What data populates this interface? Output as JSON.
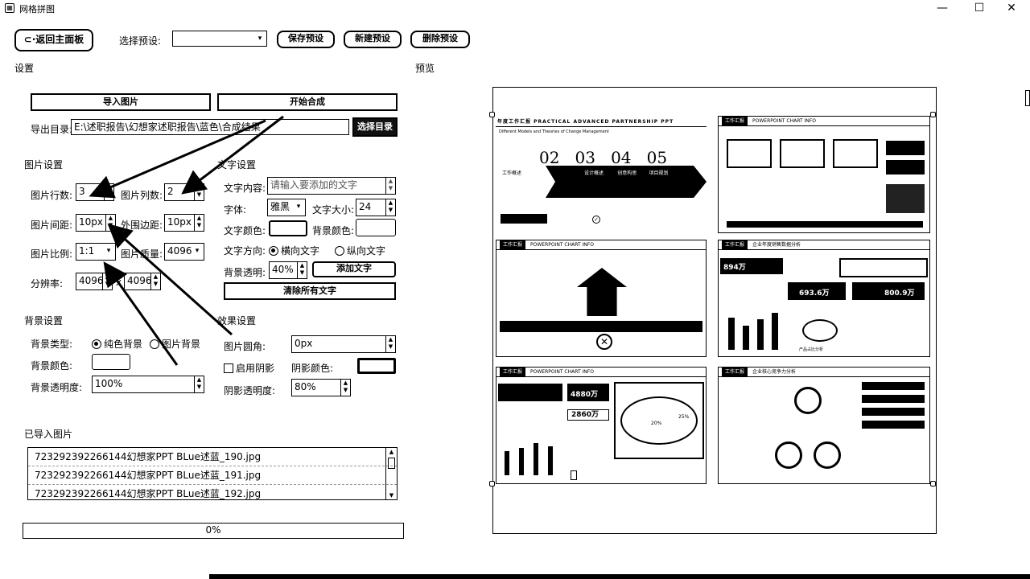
{
  "window": {
    "title": "网格拼图",
    "minimize": "—",
    "maximize": "☐",
    "close": "✕"
  },
  "toolbar": {
    "back_label": "返回主面板",
    "preset_label": "选择预设:",
    "preset_value": "",
    "save_preset": "保存预设",
    "new_preset": "新建预设",
    "delete_preset": "删除预设"
  },
  "settings": {
    "header": "设置",
    "import_button": "导入图片",
    "start_button": "开始合成",
    "export_label": "导出目录:",
    "export_path": "E:\\述职报告\\幻想家述职报告\\蓝色\\合成结果",
    "choose_dir": "选择目录"
  },
  "image_settings": {
    "header": "图片设置",
    "rows_label": "图片行数:",
    "rows_value": "3",
    "cols_label": "图片列数:",
    "cols_value": "2",
    "spacing_label": "图片间距:",
    "spacing_value": "10px",
    "margin_label": "外围边距:",
    "margin_value": "10px",
    "ratio_label": "图片比例:",
    "ratio_value": "1:1",
    "quality_label": "图片质量:",
    "quality_value": "4096",
    "resolution_label": "分辨率:",
    "res_w": "4096",
    "res_x": "x",
    "res_h": "4096"
  },
  "text_settings": {
    "header": "文字设置",
    "content_label": "文字内容:",
    "content_placeholder": "请输入要添加的文字",
    "font_label": "字体:",
    "font_value": "雅黑",
    "size_label": "文字大小:",
    "size_value": "24",
    "color_label": "文字颜色:",
    "bg_color_label": "背景颜色:",
    "direction_label": "文字方向:",
    "horizontal": "横向文字",
    "vertical": "纵向文字",
    "bg_opacity_label": "背景透明:",
    "bg_opacity_value": "40%",
    "add_text": "添加文字",
    "clear_text": "清除所有文字"
  },
  "bg_settings": {
    "header": "背景设置",
    "type_label": "背景类型:",
    "solid": "纯色背景",
    "image": "图片背景",
    "color_label": "背景颜色:",
    "opacity_label": "背景透明度:",
    "opacity_value": "100%"
  },
  "effect_settings": {
    "header": "效果设置",
    "corner_label": "图片圆角:",
    "corner_value": "0px",
    "shadow_label": "启用阴影",
    "shadow_color_label": "阴影颜色:",
    "shadow_opacity_label": "阴影透明度:",
    "shadow_opacity_value": "80%"
  },
  "imported": {
    "header": "已导入图片",
    "files": [
      "723292392266144幻想家PPT BLue述蓝_190.jpg",
      "723292392266144幻想家PPT BLue述蓝_191.jpg",
      "723292392266144幻想家PPT BLue述蓝_192.jpg"
    ]
  },
  "progress": {
    "value": 0,
    "label": "0%"
  },
  "preview": {
    "header": "预览",
    "p1_title": "年度工作汇报  PRACTICAL ADVANCED PARTNERSHIP PPT",
    "p1_subtitle": "Different Models and Theories of Change Management",
    "p1_nums": [
      "02",
      "03",
      "04",
      "05"
    ],
    "p1_left": "工作概述",
    "p1_tabs": [
      "设计概述",
      "创意构思",
      "项目规划"
    ],
    "tag": "工作汇报",
    "ppt_info": "POWERPOINT CHART INFO",
    "p4_title": "企业年度销售数据分析",
    "p4_v1": "894万",
    "p4_v2": "693.6万",
    "p4_v3": "800.9万",
    "p5_v1": "4880万",
    "p5_v2": "2860万",
    "p5_pct1": "20%",
    "p5_pct2": "25%",
    "p6_title": "企业核心竞争力分析",
    "product_label": "产品占比分析"
  }
}
